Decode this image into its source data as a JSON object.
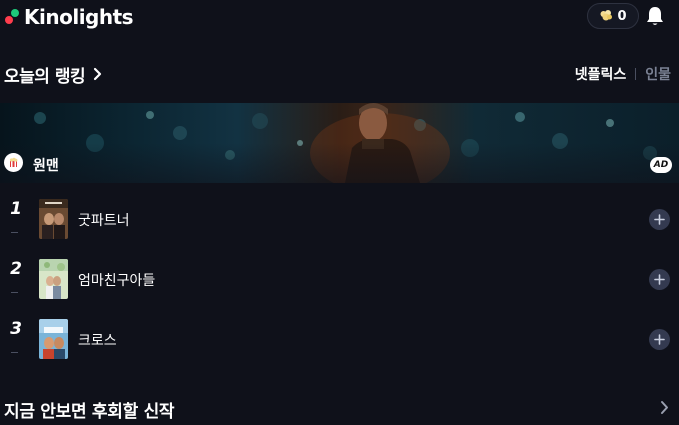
{
  "header": {
    "logo_text": "Kinolights",
    "popcorn_count": "0",
    "icons": {
      "popcorn": "popcorn-icon",
      "notifications": "bell-icon"
    }
  },
  "ranking": {
    "title": "오늘의 랭킹",
    "tabs": [
      {
        "label": "넷플릭스",
        "active": true
      },
      {
        "label": "인물",
        "active": false
      }
    ]
  },
  "banner": {
    "title": "원맨",
    "ad_label": "AD"
  },
  "ranking_list": [
    {
      "rank": "1",
      "title": "굿파트너"
    },
    {
      "rank": "2",
      "title": "엄마친구아들"
    },
    {
      "rank": "3",
      "title": "크로스"
    }
  ],
  "new_releases": {
    "title": "지금 안보면 후회할 신작"
  },
  "colors": {
    "background": "#0f111a",
    "logo_green": "#1ec97a",
    "logo_red": "#ff3d4d",
    "tab_inactive": "#7a8193",
    "add_button": "#343a50"
  }
}
